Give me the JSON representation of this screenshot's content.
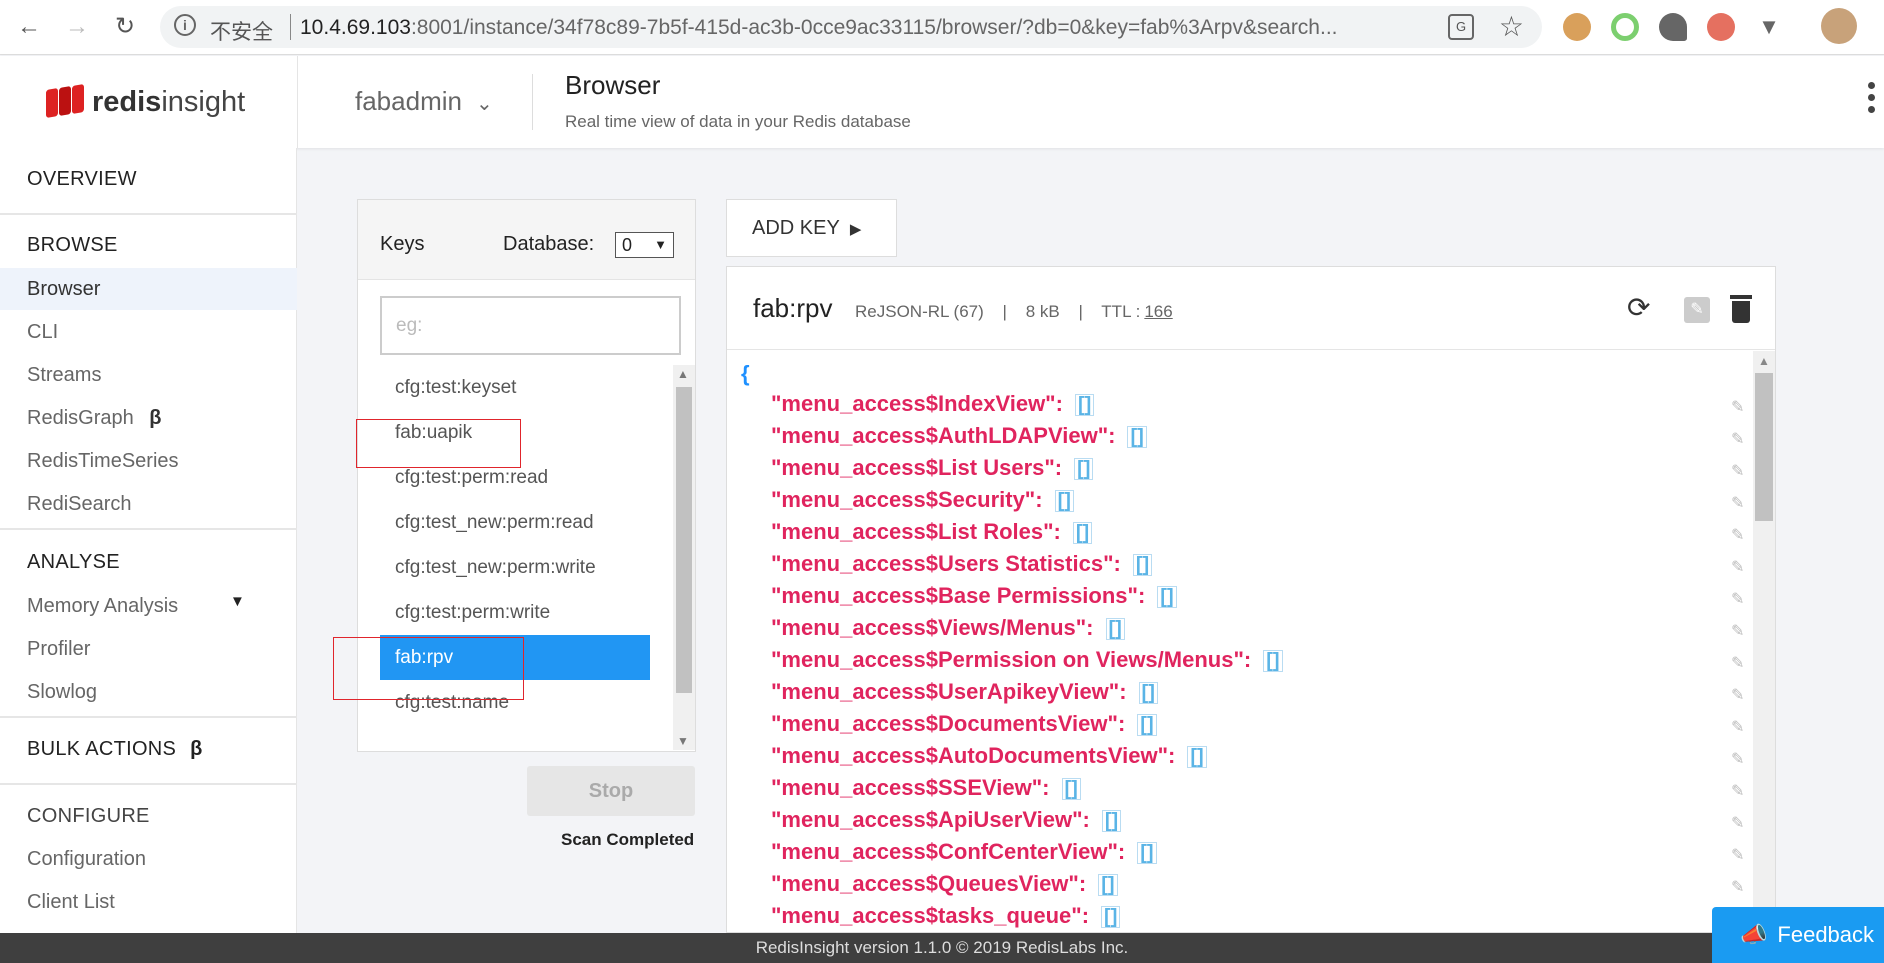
{
  "browser": {
    "security_label": "不安全",
    "url_host": "10.4.69.103",
    "url_rest": ":8001/instance/34f78c89-7b5f-415d-ac3b-0cce9ac33115/browser/?db=0&key=fab%3Arpv&search..."
  },
  "header": {
    "logo_bold": "redis",
    "logo_light": "insight",
    "database_name": "fabadmin",
    "page_title": "Browser",
    "page_subtitle": "Real time view of data in your Redis database"
  },
  "sidebar": {
    "overview": "OVERVIEW",
    "browse": "BROWSE",
    "browser": "Browser",
    "cli": "CLI",
    "streams": "Streams",
    "redisgraph": "RedisGraph",
    "beta": "β",
    "redistimeseries": "RedisTimeSeries",
    "redisearch": "RediSearch",
    "analyse": "ANALYSE",
    "memory_analysis": "Memory Analysis",
    "profiler": "Profiler",
    "slowlog": "Slowlog",
    "bulk_actions": "BULK ACTIONS",
    "configure": "CONFIGURE",
    "configuration": "Configuration",
    "client_list": "Client List"
  },
  "keys": {
    "title": "Keys",
    "database_label": "Database:",
    "database_value": "0",
    "search_placeholder": "eg:",
    "items": [
      "cfg:test:keyset",
      "fab:uapik",
      "cfg:test:perm:read",
      "cfg:test_new:perm:read",
      "cfg:test_new:perm:write",
      "cfg:test:perm:write",
      "fab:rpv",
      "cfg:test:name"
    ],
    "selected": "fab:rpv",
    "stop_label": "Stop",
    "scan_status": "Scan Completed"
  },
  "value": {
    "add_key_label": "ADD KEY",
    "key_name": "fab:rpv",
    "type": "ReJSON-RL (67)",
    "size": "8 kB",
    "ttl_label": "TTL :",
    "ttl_value": "166",
    "open_brace": "{",
    "entries": [
      {
        "key": "\"menu_access$IndexView\":",
        "value": "[]"
      },
      {
        "key": "\"menu_access$AuthLDAPView\":",
        "value": "[]"
      },
      {
        "key": "\"menu_access$List Users\":",
        "value": "[]"
      },
      {
        "key": "\"menu_access$Security\":",
        "value": "[]"
      },
      {
        "key": "\"menu_access$List Roles\":",
        "value": "[]"
      },
      {
        "key": "\"menu_access$Users Statistics\":",
        "value": "[]"
      },
      {
        "key": "\"menu_access$Base Permissions\":",
        "value": "[]"
      },
      {
        "key": "\"menu_access$Views/Menus\":",
        "value": "[]"
      },
      {
        "key": "\"menu_access$Permission on Views/Menus\":",
        "value": "[]"
      },
      {
        "key": "\"menu_access$UserApikeyView\":",
        "value": "[]"
      },
      {
        "key": "\"menu_access$DocumentsView\":",
        "value": "[]"
      },
      {
        "key": "\"menu_access$AutoDocumentsView\":",
        "value": "[]"
      },
      {
        "key": "\"menu_access$SSEView\":",
        "value": "[]"
      },
      {
        "key": "\"menu_access$ApiUserView\":",
        "value": "[]"
      },
      {
        "key": "\"menu_access$ConfCenterView\":",
        "value": "[]"
      },
      {
        "key": "\"menu_access$QueuesView\":",
        "value": "[]"
      },
      {
        "key": "\"menu_access$tasks_queue\":",
        "value": "[]"
      }
    ]
  },
  "footer": {
    "text": "RedisInsight version 1.1.0 © 2019 RedisLabs Inc.",
    "feedback_label": "Feedback"
  },
  "colors": {
    "accent": "#2196f3",
    "json_key": "#e0245e",
    "json_value": "#5ab4e6",
    "annotation_box": "#e0252c",
    "feedback": "#1a9bf2"
  }
}
